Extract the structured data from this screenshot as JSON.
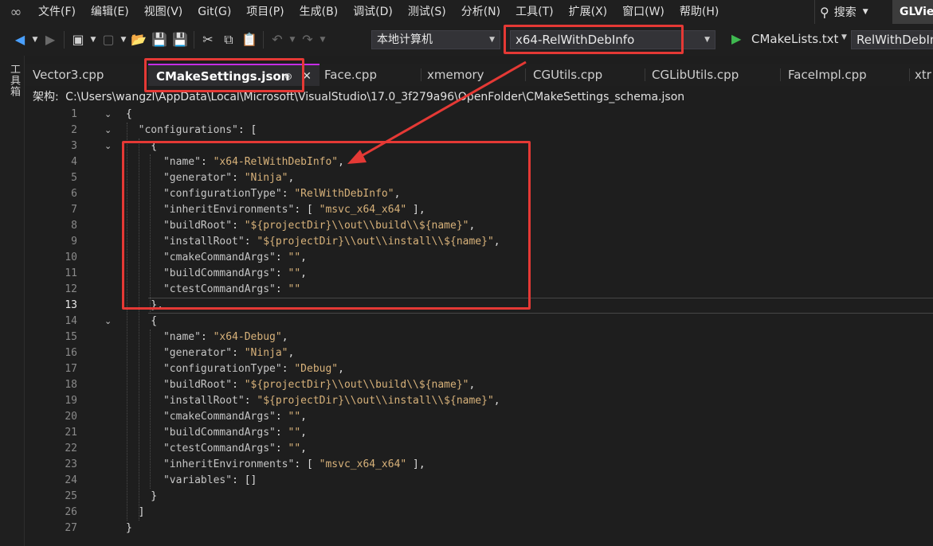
{
  "menubar": {
    "items": [
      "文件(F)",
      "编辑(E)",
      "视图(V)",
      "Git(G)",
      "项目(P)",
      "生成(B)",
      "调试(D)",
      "测试(S)",
      "分析(N)",
      "工具(T)",
      "扩展(X)",
      "窗口(W)",
      "帮助(H)"
    ],
    "search_label": "搜索",
    "solution_name": "GLVie"
  },
  "toolbar": {
    "target_machine": "本地计算机",
    "configuration": "x64-RelWithDebInfo",
    "startup_item": "CMakeLists.txt",
    "right_combo": "RelWithDebIn"
  },
  "left_strip": {
    "label": "工具箱"
  },
  "tabs": [
    {
      "label": "Vector3.cpp"
    },
    {
      "label": "CMakeSettings.json",
      "active": true
    },
    {
      "label": "Face.cpp"
    },
    {
      "label": "xmemory"
    },
    {
      "label": "CGUtils.cpp"
    },
    {
      "label": "CGLibUtils.cpp"
    },
    {
      "label": "FaceImpl.cpp"
    },
    {
      "label": "xtr"
    }
  ],
  "pathbar": {
    "label": "架构:",
    "path": "C:\\Users\\wangzl\\AppData\\Local\\Microsoft\\VisualStudio\\17.0_3f279a96\\OpenFolder\\CMakeSettings_schema.json"
  },
  "editor": {
    "current_line": 13,
    "lines": [
      {
        "n": "1",
        "t": "{"
      },
      {
        "n": "2",
        "t": "  \"configurations\": ["
      },
      {
        "n": "3",
        "t": "    {"
      },
      {
        "n": "4",
        "t": "      \"name\": \"x64-RelWithDebInfo\","
      },
      {
        "n": "5",
        "t": "      \"generator\": \"Ninja\","
      },
      {
        "n": "6",
        "t": "      \"configurationType\": \"RelWithDebInfo\","
      },
      {
        "n": "7",
        "t": "      \"inheritEnvironments\": [ \"msvc_x64_x64\" ],"
      },
      {
        "n": "8",
        "t": "      \"buildRoot\": \"${projectDir}\\\\out\\\\build\\\\${name}\","
      },
      {
        "n": "9",
        "t": "      \"installRoot\": \"${projectDir}\\\\out\\\\install\\\\${name}\","
      },
      {
        "n": "10",
        "t": "      \"cmakeCommandArgs\": \"\","
      },
      {
        "n": "11",
        "t": "      \"buildCommandArgs\": \"\","
      },
      {
        "n": "12",
        "t": "      \"ctestCommandArgs\": \"\""
      },
      {
        "n": "13",
        "t": "    },"
      },
      {
        "n": "14",
        "t": "    {"
      },
      {
        "n": "15",
        "t": "      \"name\": \"x64-Debug\","
      },
      {
        "n": "16",
        "t": "      \"generator\": \"Ninja\","
      },
      {
        "n": "17",
        "t": "      \"configurationType\": \"Debug\","
      },
      {
        "n": "18",
        "t": "      \"buildRoot\": \"${projectDir}\\\\out\\\\build\\\\${name}\","
      },
      {
        "n": "19",
        "t": "      \"installRoot\": \"${projectDir}\\\\out\\\\install\\\\${name}\","
      },
      {
        "n": "20",
        "t": "      \"cmakeCommandArgs\": \"\","
      },
      {
        "n": "21",
        "t": "      \"buildCommandArgs\": \"\","
      },
      {
        "n": "22",
        "t": "      \"ctestCommandArgs\": \"\","
      },
      {
        "n": "23",
        "t": "      \"inheritEnvironments\": [ \"msvc_x64_x64\" ],"
      },
      {
        "n": "24",
        "t": "      \"variables\": []"
      },
      {
        "n": "25",
        "t": "    }"
      },
      {
        "n": "26",
        "t": "  ]"
      },
      {
        "n": "27",
        "t": "}"
      }
    ]
  },
  "colors": {
    "annotation_red": "#e53935",
    "string": "#d8b27a",
    "active_tab_accent": "#c52de6",
    "run_green": "#3fb950"
  }
}
